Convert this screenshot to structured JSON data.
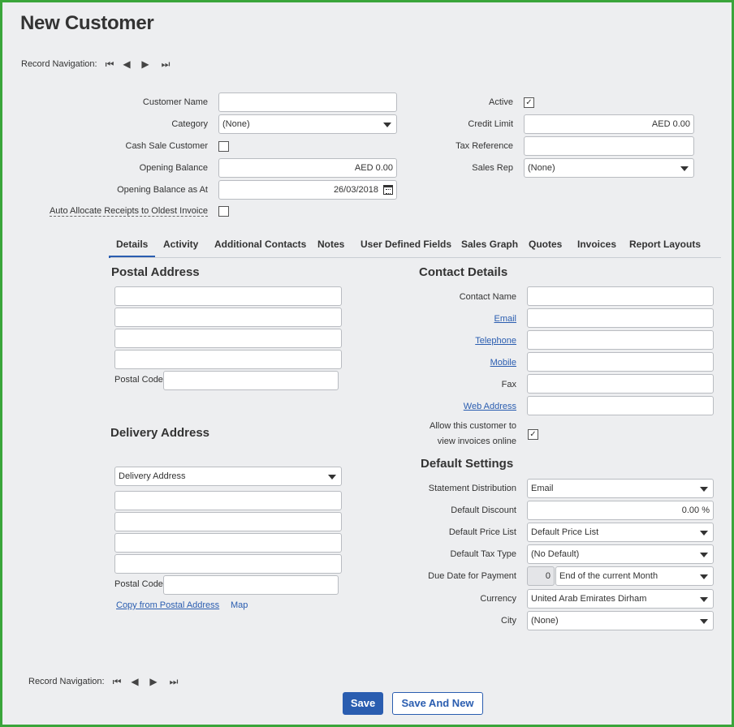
{
  "page": {
    "title": "New Customer"
  },
  "record_nav": {
    "label": "Record Navigation:",
    "first": "⏮",
    "prev": "◀",
    "next": "▶",
    "last": "⏭"
  },
  "form": {
    "customer_name": {
      "label": "Customer Name",
      "value": ""
    },
    "category": {
      "label": "Category",
      "value": "(None)"
    },
    "cash_sale": {
      "label": "Cash Sale Customer",
      "checked": ""
    },
    "opening_balance": {
      "label": "Opening Balance",
      "value": "AED 0.00"
    },
    "opening_balance_at": {
      "label": "Opening Balance as At",
      "value": "26/03/2018"
    },
    "auto_allocate": {
      "label": "Auto Allocate Receipts to Oldest Invoice",
      "checked": ""
    },
    "active": {
      "label": "Active",
      "checked": "✓"
    },
    "credit_limit": {
      "label": "Credit Limit",
      "value": "AED 0.00"
    },
    "tax_reference": {
      "label": "Tax Reference",
      "value": ""
    },
    "sales_rep": {
      "label": "Sales Rep",
      "value": "(None)"
    }
  },
  "tabs": [
    {
      "label": "Details"
    },
    {
      "label": "Activity"
    },
    {
      "label": "Additional Contacts"
    },
    {
      "label": "Notes"
    },
    {
      "label": "User Defined Fields"
    },
    {
      "label": "Sales Graph"
    },
    {
      "label": "Quotes"
    },
    {
      "label": "Invoices"
    },
    {
      "label": "Report Layouts"
    }
  ],
  "postal": {
    "heading": "Postal Address",
    "postal_code_label": "Postal Code"
  },
  "delivery": {
    "heading": "Delivery Address",
    "select_value": "Delivery Address",
    "postal_code_label": "Postal Code",
    "copy_link": "Copy from Postal Address",
    "map_link": "Map"
  },
  "contact": {
    "heading": "Contact Details",
    "contact_name": "Contact Name",
    "email": "Email",
    "telephone": "Telephone",
    "mobile": "Mobile",
    "fax": "Fax",
    "web_address": "Web Address",
    "allow_online_1": "Allow this customer to",
    "allow_online_2": "view invoices online",
    "allow_online_checked": "✓"
  },
  "defaults": {
    "heading": "Default Settings",
    "statement_distribution": {
      "label": "Statement Distribution",
      "value": "Email"
    },
    "default_discount": {
      "label": "Default Discount",
      "value": "0.00 %"
    },
    "default_price_list": {
      "label": "Default Price List",
      "value": "Default Price List"
    },
    "default_tax_type": {
      "label": "Default Tax Type",
      "value": "(No Default)"
    },
    "due_date": {
      "label": "Due Date for Payment",
      "days": "0",
      "value": "End of the current Month"
    },
    "currency": {
      "label": "Currency",
      "value": "United Arab Emirates Dirham"
    },
    "city": {
      "label": "City",
      "value": "(None)"
    }
  },
  "buttons": {
    "save": "Save",
    "save_and_new": "Save And New"
  },
  "colors": {
    "accent": "#2a5db0",
    "frame": "#3aa53a",
    "background": "#edeef0"
  }
}
